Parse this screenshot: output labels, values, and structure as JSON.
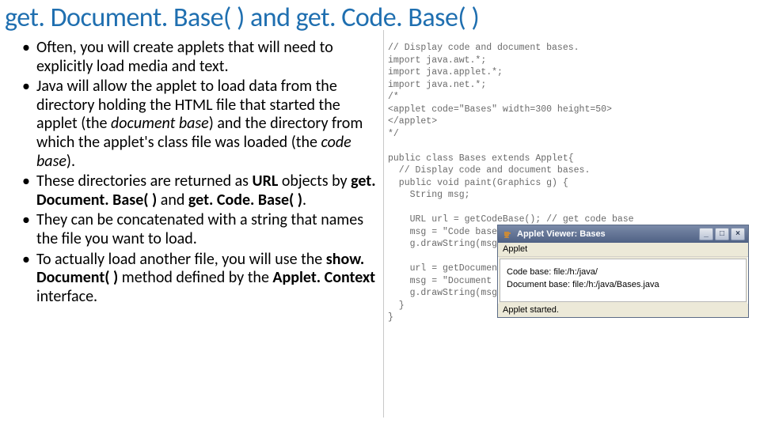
{
  "title": "get. Document. Base( ) and get. Code. Base( )",
  "bullets": [
    {
      "segments": [
        {
          "t": "Often, you will create applets that will need to explicitly load media and text."
        }
      ]
    },
    {
      "segments": [
        {
          "t": "Java will allow the applet to load data from the directory holding the HTML file that started the applet (the "
        },
        {
          "t": "document base",
          "em": true
        },
        {
          "t": ") and the directory from which the applet's class file was loaded (the "
        },
        {
          "t": "code base",
          "em": true
        },
        {
          "t": ")."
        }
      ]
    },
    {
      "segments": [
        {
          "t": "These directories are returned as "
        },
        {
          "t": "URL",
          "b": true
        },
        {
          "t": " objects by "
        },
        {
          "t": "get. Document. Base( )",
          "b": true
        },
        {
          "t": " and "
        },
        {
          "t": "get. Code. Base( )",
          "b": true
        },
        {
          "t": "."
        }
      ]
    },
    {
      "segments": [
        {
          "t": "They can be concatenated with a string that names the file you want to load."
        }
      ]
    },
    {
      "segments": [
        {
          "t": "To actually load another file, you will use the "
        },
        {
          "t": "show. Document( )",
          "b": true
        },
        {
          "t": " method defined by the "
        },
        {
          "t": "Applet. Context",
          "b": true
        },
        {
          "t": " interface."
        }
      ]
    }
  ],
  "code": "// Display code and document bases.\nimport java.awt.*;\nimport java.applet.*;\nimport java.net.*;\n/*\n<applet code=\"Bases\" width=300 height=50>\n</applet>\n*/\n\npublic class Bases extends Applet{\n  // Display code and document bases.\n  public void paint(Graphics g) {\n    String msg;\n\n    URL url = getCodeBase(); // get code base\n    msg = \"Code base: \" + url.toString();\n    g.drawString(msg, 10, 20);\n\n    url = getDocumentBase(); // get document base\n    msg = \"Document base: \" + url.toString();\n    g.drawString(msg, 10, 40);\n  }\n}",
  "applet": {
    "windowTitle": "Applet Viewer: Bases",
    "menu": "Applet",
    "line1": "Code base: file:/h:/java/",
    "line2": "Document base: file:/h:/java/Bases.java",
    "status": "Applet started.",
    "btnMin": "_",
    "btnMax": "□",
    "btnClose": "×"
  }
}
